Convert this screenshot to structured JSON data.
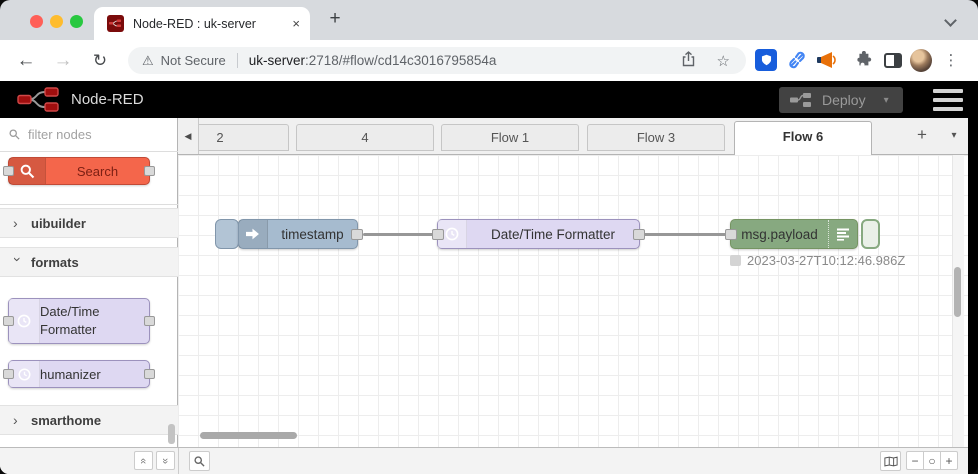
{
  "browser": {
    "tab_title": "Node-RED : uk-server",
    "close_glyph": "×",
    "new_tab_glyph": "+",
    "back_glyph": "←",
    "forward_glyph": "→",
    "reload_glyph": "↻",
    "warning_glyph": "⚠",
    "security_label": "Not Secure",
    "url_host": "uk-server",
    "url_rest": ":2718/#flow/cd14c3016795854a",
    "star_glyph": "☆",
    "menu_glyph": "⋮",
    "traffic_light_colors": [
      "#ff5f57",
      "#febc2e",
      "#28c840"
    ]
  },
  "nd_header": {
    "brand": "Node-RED",
    "deploy_label": "Deploy",
    "deploy_caret": "▾",
    "brand_red": "#8f0000"
  },
  "palette": {
    "filter_placeholder": "filter nodes",
    "search_node": {
      "label": "Search",
      "color": "#f4664b"
    },
    "categories": [
      {
        "label": "uibuilder",
        "chevron": "›",
        "expanded": false
      },
      {
        "label": "formats",
        "chevron": "›",
        "expanded": true
      },
      {
        "label": "smarthome",
        "chevron": "›",
        "expanded": false
      }
    ],
    "format_nodes": {
      "datetime_line1": "Date/Time",
      "datetime_line2": "Formatter",
      "humanizer": "humanizer",
      "color": "#ded8f2"
    }
  },
  "workspace": {
    "scroll_left_glyph": "◀",
    "tabs": [
      {
        "label": "2"
      },
      {
        "label": "4"
      },
      {
        "label": "Flow 1"
      },
      {
        "label": "Flow 3"
      },
      {
        "label": "Flow 6"
      }
    ],
    "active_tab": "Flow 6",
    "add_tab_glyph": "+",
    "tab_menu_glyph": "▾",
    "flow": {
      "inject_label": "timestamp",
      "inject_color": "#a6bbcf",
      "formatter_label": "Date/Time Formatter",
      "formatter_color": "#ded8f2",
      "debug_label": "msg.payload",
      "debug_color": "#87a980",
      "debug_status": "2023-03-27T10:12:46.986Z"
    }
  },
  "footer": {
    "collapse_all_glyph": "«",
    "expand_all_glyph": "»",
    "zoom_out_glyph": "−",
    "zoom_reset_glyph": "○",
    "zoom_in_glyph": "+"
  }
}
